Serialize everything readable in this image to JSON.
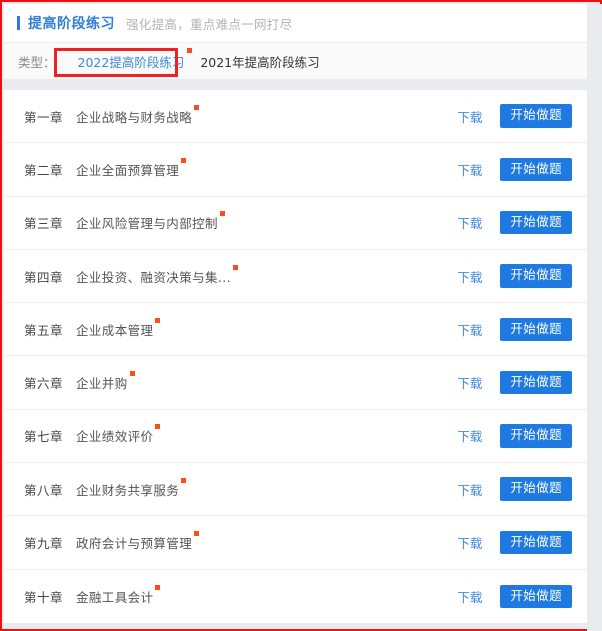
{
  "colors": {
    "accent_blue": "#2f7fd8",
    "button_blue": "#1e7ae0",
    "link_blue": "#3c8ade",
    "badge_red": "#ff4d19",
    "annotation_red": "#ee2222",
    "page_bg": "#e9ebee"
  },
  "header": {
    "title": "提高阶段练习",
    "subtitle": "强化提高，重点难点一网打尽"
  },
  "filter": {
    "label": "类型：",
    "tabs": [
      {
        "label": "2022提高阶段练习",
        "active": true,
        "badge": true
      },
      {
        "label": "2021年提高阶段练习",
        "active": false,
        "badge": false
      }
    ]
  },
  "actions": {
    "download_label": "下载",
    "start_label": "开始做题"
  },
  "chapters": [
    {
      "no": "第一章",
      "title": "企业战略与财务战略",
      "badge": true
    },
    {
      "no": "第二章",
      "title": "企业全面预算管理",
      "badge": true
    },
    {
      "no": "第三章",
      "title": "企业风险管理与内部控制",
      "badge": true
    },
    {
      "no": "第四章",
      "title": "企业投资、融资决策与集...",
      "badge": true
    },
    {
      "no": "第五章",
      "title": "企业成本管理",
      "badge": true
    },
    {
      "no": "第六章",
      "title": "企业并购",
      "badge": true
    },
    {
      "no": "第七章",
      "title": "企业绩效评价",
      "badge": true
    },
    {
      "no": "第八章",
      "title": "企业财务共享服务",
      "badge": true
    },
    {
      "no": "第九章",
      "title": "政府会计与预算管理",
      "badge": true
    },
    {
      "no": "第十章",
      "title": "金融工具会计",
      "badge": true
    }
  ]
}
